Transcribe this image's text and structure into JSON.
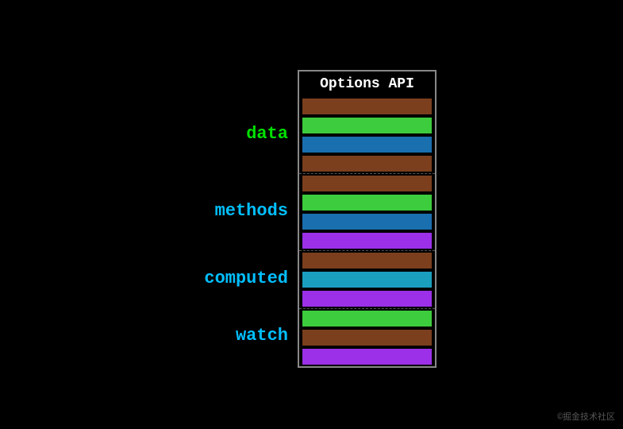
{
  "title": "Options API",
  "watermark": "©掘金技术社区",
  "sections": [
    {
      "label": "data",
      "labelColor": "green",
      "bars": [
        "brown",
        "green",
        "blue",
        "brown"
      ]
    },
    {
      "label": "methods",
      "labelColor": "cyan",
      "bars": [
        "brown",
        "green",
        "blue",
        "purple"
      ]
    },
    {
      "label": "computed",
      "labelColor": "cyan",
      "bars": [
        "brown",
        "teal",
        "purple"
      ]
    },
    {
      "label": "watch",
      "labelColor": "cyan",
      "bars": [
        "green",
        "brown",
        "purple"
      ]
    }
  ],
  "colors": {
    "brown": "#7b3f1e",
    "green": "#3dcc3d",
    "blue": "#1a6faf",
    "purple": "#9b30e8",
    "teal": "#1a9fbf"
  }
}
